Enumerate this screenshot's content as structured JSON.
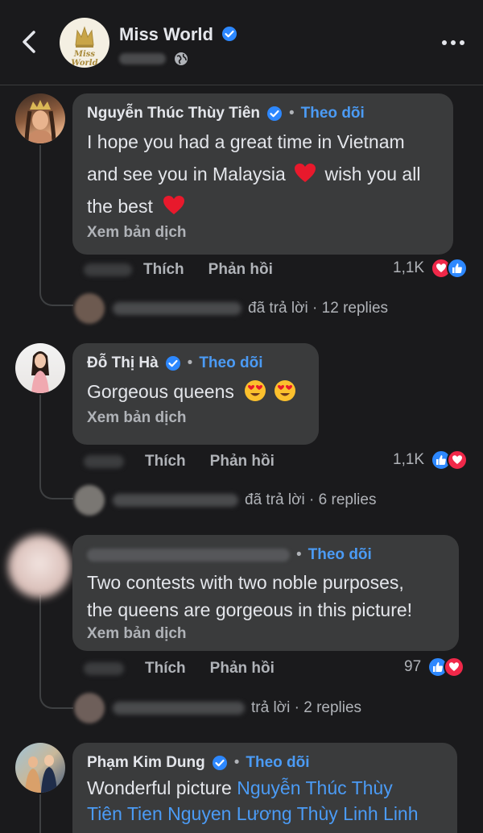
{
  "header": {
    "page_name": "Miss World",
    "logo_text": "Miss World",
    "icons": {
      "back": "chevron-left-icon",
      "verified": "verified-badge-icon",
      "audience": "globe-icon",
      "more": "more-horizontal-icon"
    }
  },
  "comments": [
    {
      "author": "Nguyễn Thúc Thùy Tiên",
      "follow": "Theo dõi",
      "dot": "•",
      "lines": [
        "I hope you had a great time in Vietnam",
        "and see you in Malaysia",
        "wish you all",
        "the best"
      ],
      "translate": "Xem bản dịch",
      "like_label": "Thích",
      "reply_label": "Phản hồi",
      "reaction_count": "1,1K",
      "reply_summary": "đã trả lời · 12 replies"
    },
    {
      "author": "Đỗ Thị Hà",
      "follow": "Theo dõi",
      "dot": "•",
      "text": "Gorgeous queens",
      "translate": "Xem bản dịch",
      "like_label": "Thích",
      "reply_label": "Phản hồi",
      "reaction_count": "1,1K",
      "reply_summary": "đã trả lời · 6 replies"
    },
    {
      "follow": "Theo dõi",
      "dot": "•",
      "lines": [
        "Two contests with two noble purposes,",
        "the queens are gorgeous in this picture!"
      ],
      "translate": "Xem bản dịch",
      "like_label": "Thích",
      "reply_label": "Phản hồi",
      "reaction_count": "97",
      "reply_summary": "trả lời · 2 replies"
    },
    {
      "author": "Phạm Kim Dung",
      "follow": "Theo dõi",
      "dot": "•",
      "text_prefix": "Wonderful picture ",
      "mention_1": "Nguyễn Thúc Thùy",
      "mention_2": "Tiên Tien Nguyen Lương Thùy Linh Linh"
    }
  ],
  "colors": {
    "background": "#1a1a1c",
    "bubble": "#3a3b3c",
    "link": "#4b9bf5",
    "like": "#2d88ff",
    "love": "#f02849"
  }
}
